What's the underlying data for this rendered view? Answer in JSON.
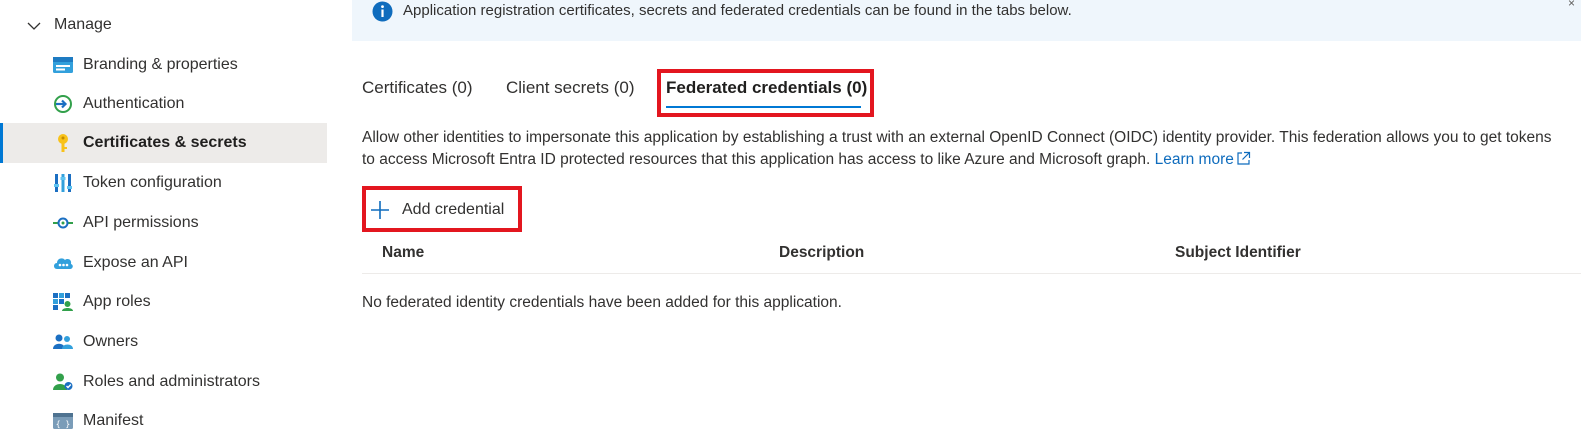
{
  "sidebar": {
    "group_label": "Manage",
    "items": [
      {
        "label": "Branding & properties",
        "icon": "branding-icon"
      },
      {
        "label": "Authentication",
        "icon": "authentication-icon"
      },
      {
        "label": "Certificates & secrets",
        "icon": "key-icon",
        "selected": true
      },
      {
        "label": "Token configuration",
        "icon": "token-config-icon"
      },
      {
        "label": "API permissions",
        "icon": "api-permissions-icon"
      },
      {
        "label": "Expose an API",
        "icon": "cloud-api-icon"
      },
      {
        "label": "App roles",
        "icon": "app-roles-icon"
      },
      {
        "label": "Owners",
        "icon": "owners-icon"
      },
      {
        "label": "Roles and administrators",
        "icon": "roles-admin-icon"
      },
      {
        "label": "Manifest",
        "icon": "manifest-icon"
      }
    ]
  },
  "banner": {
    "text": "Application registration certificates, secrets and federated credentials can be found in the tabs below.",
    "icon": "info-icon"
  },
  "tabs": [
    {
      "label": "Certificates (0)"
    },
    {
      "label": "Client secrets (0)"
    },
    {
      "label": "Federated credentials (0)",
      "active": true
    }
  ],
  "description": {
    "text": "Allow other identities to impersonate this application by establishing a trust with an external OpenID Connect (OIDC) identity provider. This federation allows you to get tokens to access Microsoft Entra ID protected resources that this application has access to like Azure and Microsoft graph.",
    "link_label": "Learn more"
  },
  "add_button": {
    "label": "Add credential"
  },
  "table": {
    "columns": [
      "Name",
      "Description",
      "Subject Identifier"
    ],
    "empty_message": "No federated identity credentials have been added for this application."
  },
  "colors": {
    "accent": "#0078d4",
    "highlight": "#e3161f",
    "banner_bg": "#eff6fc",
    "selected_bg": "#edebe9"
  }
}
